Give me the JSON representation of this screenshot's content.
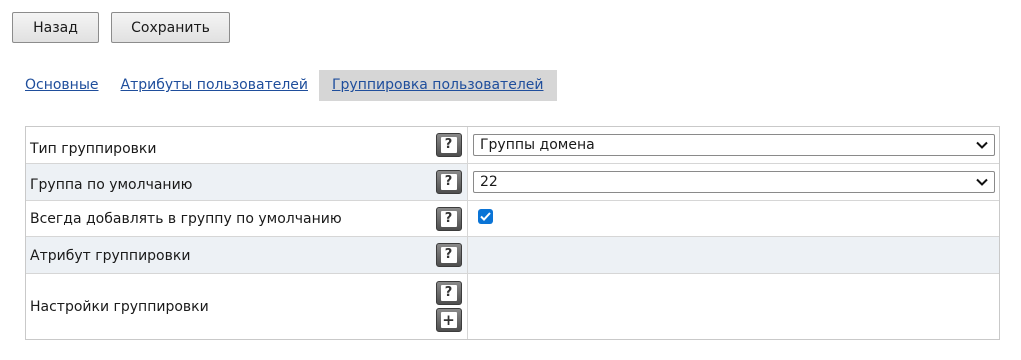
{
  "toolbar": {
    "back_label": "Назад",
    "save_label": "Сохранить"
  },
  "tabs": [
    {
      "label": "Основные",
      "active": false
    },
    {
      "label": "Атрибуты пользователей",
      "active": false
    },
    {
      "label": "Группировка пользователей",
      "active": true
    }
  ],
  "form": {
    "rows": [
      {
        "label": "Тип группировки",
        "help_icon": "question-icon",
        "control": "select",
        "value": "Группы домена"
      },
      {
        "label": "Группа по умолчанию",
        "help_icon": "question-icon",
        "control": "select",
        "value": "22"
      },
      {
        "label": "Всегда добавлять в группу по умолчанию",
        "help_icon": "question-icon",
        "control": "checkbox",
        "checked": true
      },
      {
        "label": "Атрибут группировки",
        "help_icon": "question-icon",
        "control": "none"
      },
      {
        "label": "Настройки группировки",
        "help_icon": "question-icon",
        "extra_icon": "plus-icon",
        "control": "none"
      }
    ]
  },
  "colors": {
    "link": "#1f4e9c",
    "active_tab_bg": "#d6d6d6",
    "alt_row_bg": "#edf1f5",
    "checkbox": "#0a74d6",
    "icon_button": "#5a5a5a"
  }
}
